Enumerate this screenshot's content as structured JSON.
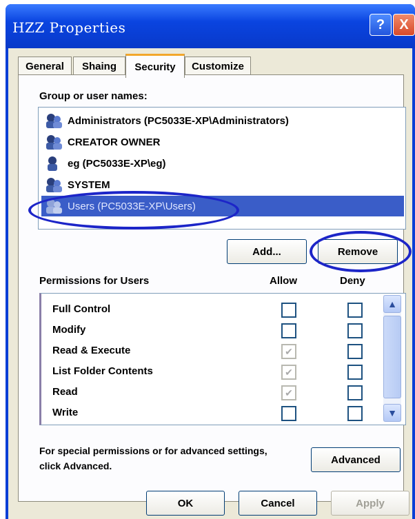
{
  "window": {
    "title": "HZZ Properties"
  },
  "titlebar_buttons": {
    "help": "?",
    "close": "X"
  },
  "tabs": [
    {
      "label": "General"
    },
    {
      "label": "Shaing"
    },
    {
      "label": "Security"
    },
    {
      "label": "Customize"
    }
  ],
  "group_label": "Group or user names:",
  "users": [
    {
      "name": "Administrators (PC5033E-XP\\Administrators)"
    },
    {
      "name": "CREATOR OWNER"
    },
    {
      "name": "eg (PC5033E-XP\\eg)"
    },
    {
      "name": "SYSTEM"
    },
    {
      "name": "Users (PC5033E-XP\\Users)"
    }
  ],
  "buttons": {
    "add": "Add...",
    "remove": "Remove",
    "advanced": "Advanced",
    "ok": "OK",
    "cancel": "Cancel",
    "apply": "Apply"
  },
  "permissions": {
    "label": "Permissions for Users",
    "allow_header": "Allow",
    "deny_header": "Deny",
    "rows": [
      {
        "name": "Full Control",
        "allow": false,
        "deny": false
      },
      {
        "name": "Modify",
        "allow": false,
        "deny": false
      },
      {
        "name": "Read & Execute",
        "allow": true,
        "deny": false
      },
      {
        "name": "List Folder Contents",
        "allow": true,
        "deny": false
      },
      {
        "name": "Read",
        "allow": true,
        "deny": false
      },
      {
        "name": "Write",
        "allow": false,
        "deny": false
      }
    ]
  },
  "advanced_note": {
    "line1": "For special permissions or for advanced settings,",
    "line2": "click Advanced."
  },
  "icons": {
    "check": "✔",
    "scroll_up": "▲",
    "scroll_down": "▼"
  },
  "colors": {
    "title_bar": "#0a44e0",
    "selection": "#3a5dc8",
    "highlight_ellipse": "#1c25c8"
  }
}
